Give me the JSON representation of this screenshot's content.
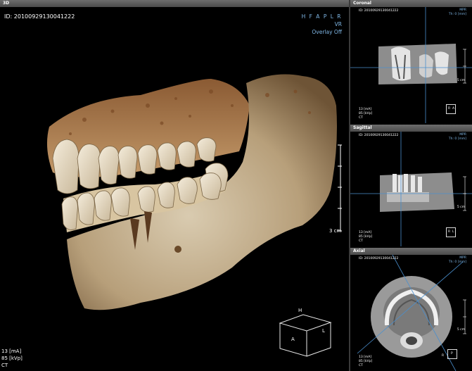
{
  "main": {
    "header": "3D",
    "id": "ID: 20100929130041222",
    "orientation": "H F A P L R",
    "render_mode": "VR",
    "overlay": "Overlay Off",
    "exposure": [
      "13 [mA]",
      "85 [kVp]",
      "CT"
    ],
    "scale": "3 cm",
    "cube": {
      "top": "H",
      "front": "A",
      "side": "L"
    }
  },
  "coronal": {
    "header": "Coronal",
    "id": "ID: 20100929130041222",
    "mode": "MPR",
    "thickness": "Th: 0 [mm]",
    "exposure": [
      "13 [mA]",
      "85 [kVp]",
      "CT"
    ],
    "scale": "5 cm",
    "orient": [
      "R",
      "A"
    ]
  },
  "sagittal": {
    "header": "Sagittal",
    "id": "ID: 20100929130041222",
    "mode": "MPR",
    "thickness": "Th: 0 [mm]",
    "exposure": [
      "13 [mA]",
      "85 [kVp]",
      "CT"
    ],
    "scale": "5 cm",
    "orient": [
      "R",
      "L"
    ]
  },
  "axial": {
    "header": "Axial",
    "id": "ID: 20100929130041222",
    "mode": "MPR",
    "thickness": "Th: 0 [mm]",
    "exposure": [
      "13 [mA]",
      "85 [kVp]",
      "CT"
    ],
    "scale": "5 cm",
    "orient": [
      "R",
      "P"
    ]
  }
}
